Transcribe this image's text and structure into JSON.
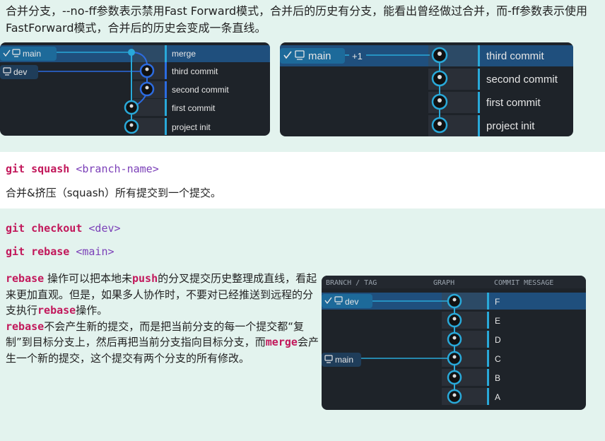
{
  "intro_text": "合并分支，--no-ff参数表示禁用Fast Forward模式，合并后的历史有分支，能看出曾经做过合并，而-ff参数表示使用FastForward模式，合并后的历史会变成一条直线。",
  "panel_noff": {
    "branches": [
      "main",
      "dev"
    ],
    "commits": [
      "merge",
      "third commit",
      "second commit",
      "first commit",
      "project init"
    ]
  },
  "panel_ff": {
    "branch": "main",
    "extra_badge": "+1",
    "commits": [
      "third commit",
      "second commit",
      "first commit",
      "project init"
    ]
  },
  "squash": {
    "command": "git squash",
    "arg": "<branch-name>",
    "description": "合并&挤压（squash）所有提交到一个提交。"
  },
  "checkout": {
    "command": "git checkout",
    "arg": "<dev>"
  },
  "rebase_cmd": {
    "command": "git rebase",
    "arg": "<main>"
  },
  "rebase_text": {
    "kw_rebase": "rebase",
    "p1a": "操作可以把本地未",
    "kw_push": "push",
    "p1b": "的分叉提交历史整理成直线，看起来更加直观。但是，如果多人协作时，不要对已经推送到远程的分支执行",
    "kw_rebase2": "rebase",
    "p1c": "操作。",
    "kw_rebase3": "rebase",
    "p2a": "不会产生新的提交，而是把当前分支的每一个提交都“复制”到目标分支上，然后再把当前分支指向目标分支，而",
    "kw_merge": "merge",
    "p2b": "会产生一个新的提交，这个提交有两个分支的所有修改。"
  },
  "panel_rebase": {
    "headers": [
      "BRANCH / TAG",
      "GRAPH",
      "COMMIT MESSAGE"
    ],
    "branches": [
      "dev",
      "main"
    ],
    "commits": [
      "F",
      "E",
      "D",
      "C",
      "B",
      "A"
    ]
  },
  "colors": {
    "section_bg": "#e3f3ee",
    "command_keyword": "#c2185b",
    "command_arg": "#7b3fb8",
    "panel_bg": "#1e2329",
    "graph_cyan": "#29a9d9",
    "graph_blue": "#2c6be0",
    "selected_row": "#1f4f7d"
  },
  "icons": [
    "checkmark-icon",
    "monitor-icon",
    "avatar-icon"
  ]
}
